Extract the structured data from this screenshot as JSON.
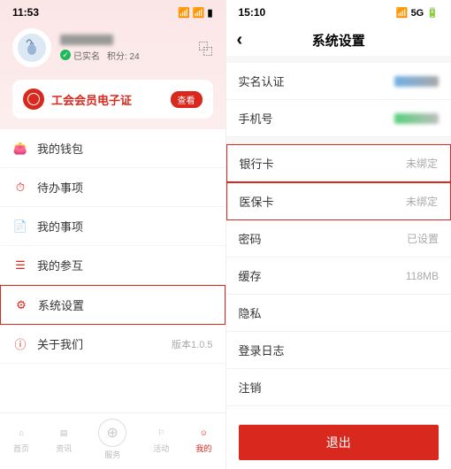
{
  "left": {
    "status_time": "11:53",
    "status_right": "📶 📶 ▮",
    "verified": "已实名",
    "points_label": "积分: 24",
    "scan": "⿻",
    "card_title": "工会会员电子证",
    "check": "查看",
    "menu": [
      {
        "icon": "👛",
        "label": "我的钱包",
        "val": "",
        "hl": false
      },
      {
        "icon": "⏱",
        "label": "待办事项",
        "val": "",
        "hl": false
      },
      {
        "icon": "📄",
        "label": "我的事项",
        "val": "",
        "hl": false
      },
      {
        "icon": "☰",
        "label": "我的参互",
        "val": "",
        "hl": false
      },
      {
        "icon": "⚙",
        "label": "系统设置",
        "val": "",
        "hl": true
      },
      {
        "icon": "ⓘ",
        "label": "关于我们",
        "val": "版本1.0.5",
        "hl": false
      }
    ],
    "tabs": [
      {
        "icon": "⌂",
        "label": "首页"
      },
      {
        "icon": "▤",
        "label": "资讯"
      },
      {
        "icon": "",
        "label": ""
      },
      {
        "icon": "⚐",
        "label": "活动"
      },
      {
        "icon": "☺",
        "label": "我的"
      }
    ],
    "center_tab": "服务"
  },
  "right": {
    "status_time": "15:10",
    "status_right": "📶 5G 🔋",
    "title": "系统设置",
    "rows": [
      {
        "label": "实名认证",
        "val": "",
        "blur": 1,
        "hl": false
      },
      {
        "label": "手机号",
        "val": "",
        "blur": 2,
        "hl": false
      },
      {
        "label": "银行卡",
        "val": "未绑定",
        "blur": 0,
        "hl": true
      },
      {
        "label": "医保卡",
        "val": "未绑定",
        "blur": 0,
        "hl": true
      },
      {
        "label": "密码",
        "val": "已设置",
        "blur": 0,
        "hl": false
      },
      {
        "label": "缓存",
        "val": "118MB",
        "blur": 0,
        "hl": false
      },
      {
        "label": "隐私",
        "val": "",
        "blur": 0,
        "hl": false
      },
      {
        "label": "登录日志",
        "val": "",
        "blur": 0,
        "hl": false
      },
      {
        "label": "注销",
        "val": "",
        "blur": 0,
        "hl": false
      }
    ],
    "logout": "退出"
  }
}
